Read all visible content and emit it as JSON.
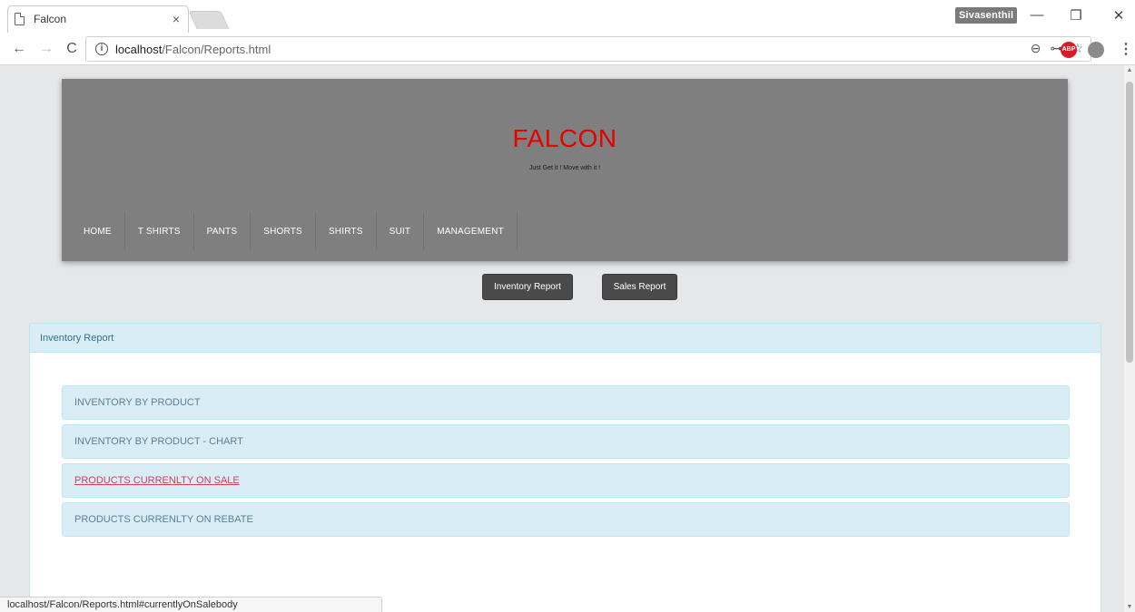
{
  "browser": {
    "tab_title": "Falcon",
    "tab_close": "×",
    "profile_name": "Sivasenthil",
    "url_host": "localhost",
    "url_path": "/Falcon/Reports.html",
    "status_url": "localhost/Falcon/Reports.html#currentlyOnSalebody",
    "buttons": {
      "back": "←",
      "forward": "→",
      "reload": "C",
      "minimize": "—",
      "restore": "❐",
      "close": "✕",
      "menu": "⋮"
    },
    "omnibox_icons": {
      "zoom": "⊖",
      "key": "⊶",
      "star": "☆"
    },
    "abp_label": "ABP"
  },
  "header": {
    "brand": "FALCON",
    "tagline": "Just Get it ! Move with it !",
    "nav": [
      "HOME",
      "T SHIRTS",
      "PANTS",
      "SHORTS",
      "SHIRTS",
      "SUIT",
      "MANAGEMENT"
    ]
  },
  "actions": {
    "inventory_report": "Inventory Report",
    "sales_report": "Sales Report"
  },
  "panel": {
    "heading": "Inventory Report",
    "items": [
      "INVENTORY BY PRODUCT",
      "INVENTORY BY PRODUCT - CHART",
      "PRODUCTS CURRENLTY ON SALE",
      "PRODUCTS CURRENLTY ON REBATE"
    ],
    "active_index": 2
  },
  "colors": {
    "brand": "#e80000",
    "header_bg": "#7f7f7f",
    "panel_heading_bg": "#d9edf7",
    "active_link": "#d43f5a"
  }
}
